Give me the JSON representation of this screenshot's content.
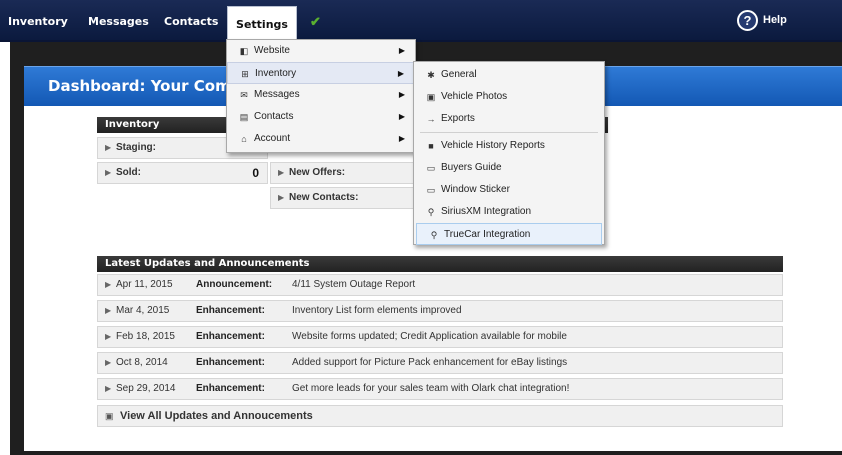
{
  "nav": {
    "items": [
      "Inventory",
      "Messages",
      "Contacts",
      "Settings"
    ],
    "help_label": "Help"
  },
  "dashboard": {
    "title": "Dashboard: Your Compa"
  },
  "inventory_panel": {
    "title": "Inventory",
    "rows": [
      {
        "label": "Staging:",
        "value": ""
      },
      {
        "label": "Sold:",
        "value": "0"
      }
    ]
  },
  "leads_panel": {
    "rows": [
      {
        "label": "New Offers:"
      },
      {
        "label": "New Contacts:"
      }
    ]
  },
  "settings_menu": {
    "items": [
      {
        "label": "Website",
        "icon": "website-icon"
      },
      {
        "label": "Inventory",
        "icon": "inventory-icon"
      },
      {
        "label": "Messages",
        "icon": "messages-icon"
      },
      {
        "label": "Contacts",
        "icon": "contacts-icon"
      },
      {
        "label": "Account",
        "icon": "account-icon"
      }
    ]
  },
  "inventory_submenu": {
    "items": [
      {
        "label": "General",
        "icon": "gear-icon"
      },
      {
        "label": "Vehicle Photos",
        "icon": "photo-icon"
      },
      {
        "label": "Exports",
        "icon": "export-icon"
      },
      {
        "label": "Vehicle History Reports",
        "icon": "report-icon"
      },
      {
        "label": "Buyers Guide",
        "icon": "guide-icon"
      },
      {
        "label": "Window Sticker",
        "icon": "sticker-icon"
      },
      {
        "label": "SiriusXM Integration",
        "icon": "integration-icon"
      },
      {
        "label": "TrueCar Integration",
        "icon": "integration-icon"
      }
    ]
  },
  "updates": {
    "title": "Latest Updates and Announcements",
    "rows": [
      {
        "date": "Apr 11, 2015",
        "type": "Announcement:",
        "text": "4/11 System Outage Report"
      },
      {
        "date": "Mar 4, 2015",
        "type": "Enhancement:",
        "text": "Inventory List form elements improved"
      },
      {
        "date": "Feb 18, 2015",
        "type": "Enhancement:",
        "text": "Website forms updated; Credit Application available for mobile"
      },
      {
        "date": "Oct 8, 2014",
        "type": "Enhancement:",
        "text": "Added support for Picture Pack enhancement for eBay listings"
      },
      {
        "date": "Sep 29, 2014",
        "type": "Enhancement:",
        "text": "Get more leads for your sales team with Olark chat integration!"
      }
    ],
    "view_all_label": "View All Updates and Annoucements"
  },
  "colors": {
    "nav_bg": "#0b1a3e",
    "header_blue": "#1358b4",
    "check_green": "#5ab030"
  }
}
